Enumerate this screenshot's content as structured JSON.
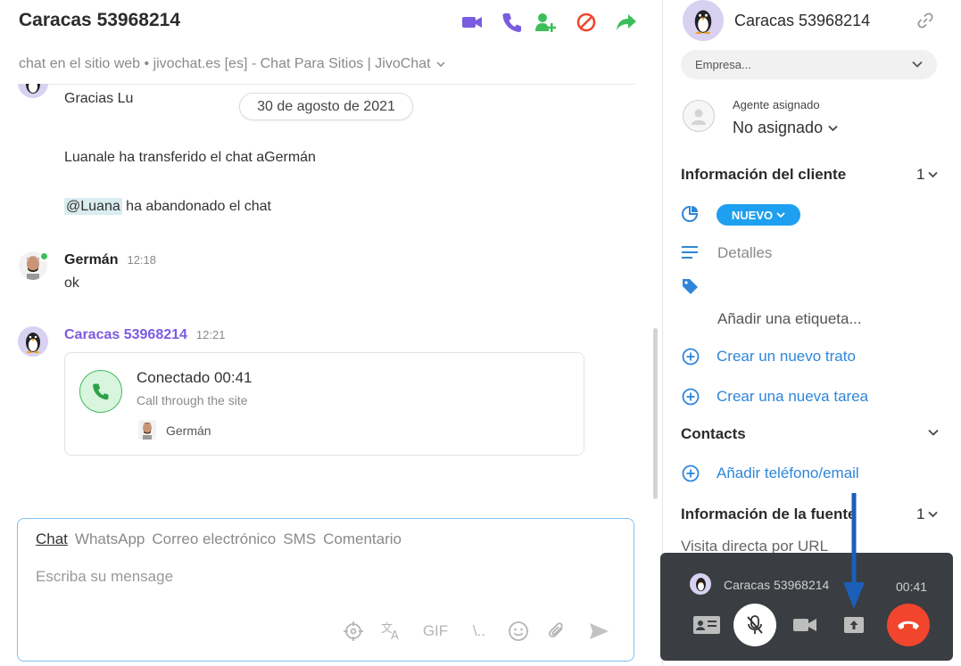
{
  "header": {
    "title": "Caracas 53968214",
    "subtitle": "chat en el sitio web • jivochat.es [es] - Chat Para Sitios | JivoChat"
  },
  "messages": {
    "thanks": "Gracias Lu",
    "date": "30 de agosto de 2021",
    "transfer": "Luanale ha transferido el chat aGermán",
    "mention": "@Luana",
    "left_chat": " ha abandonado el chat",
    "german_name": "Germán",
    "german_time": "12:18",
    "german_text": "ok",
    "visitor_name": "Caracas 53968214",
    "visitor_time": "12:21"
  },
  "call_card": {
    "status": "Conectado 00:41",
    "subtitle": "Call through the site",
    "agent": "Germán"
  },
  "composer": {
    "tabs": [
      "Chat",
      "WhatsApp",
      "Correo electrónico",
      "SMS",
      "Comentario"
    ],
    "placeholder": "Escriba su mensage",
    "gif_label": "GIF",
    "slash_label": "\\.."
  },
  "sidebar": {
    "contact_name": "Caracas 53968214",
    "company_placeholder": "Empresa...",
    "agent_label": "Agente asignado",
    "agent_value": "No asignado",
    "client_info_title": "Información del cliente",
    "client_info_count": "1",
    "status_badge": "NUEVO",
    "details_label": "Detalles",
    "add_tag": "Añadir una etiqueta...",
    "new_deal": "Crear un nuevo trato",
    "new_task": "Crear una nueva tarea",
    "contacts_title": "Contacts",
    "add_contact": "Añadir teléfono/email",
    "source_title": "Información de la fuente",
    "source_count": "1",
    "source_value": "Visita directa por URL"
  },
  "call_widget": {
    "name": "Caracas 53968214",
    "timer": "00:41"
  },
  "colors": {
    "accent_purple": "#7b5ce0",
    "accent_blue": "#2f86d9",
    "call_green": "#3cbf5a",
    "end_call_red": "#f2452d",
    "badge_blue": "#1ea0f0"
  }
}
